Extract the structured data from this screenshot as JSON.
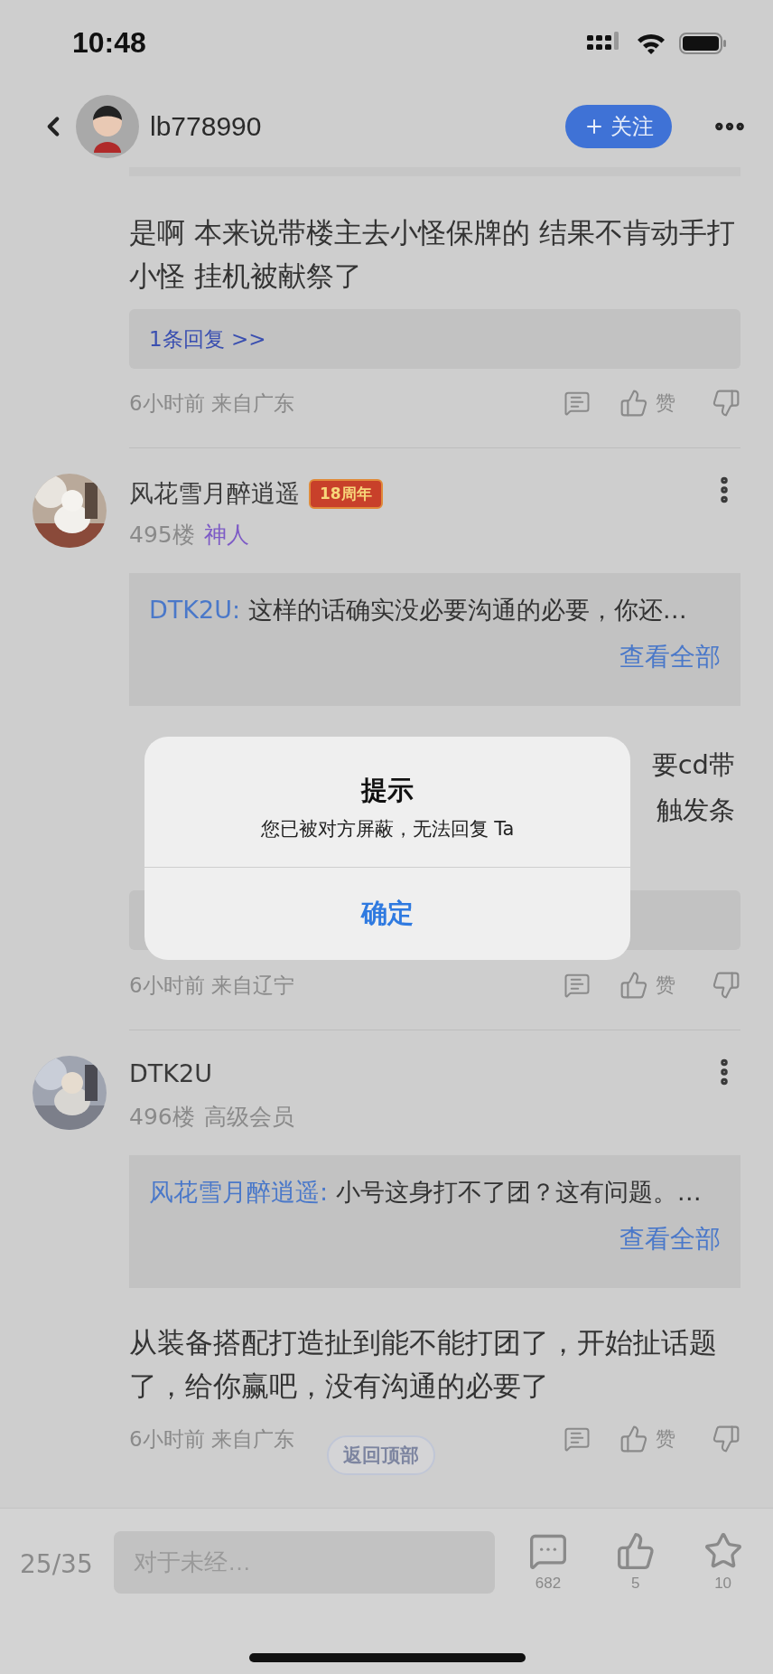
{
  "status_bar": {
    "time": "10:48"
  },
  "header": {
    "username": "lb778990",
    "follow_label": "关注"
  },
  "posts": [
    {
      "kind": "tail",
      "body": {
        "kind": "text",
        "text": "是啊 本来说带楼主去小怪保牌的 结果不肯动手打小怪 挂机被献祭了"
      },
      "replies": {
        "kind": "link",
        "text": "1条回复 >>"
      },
      "time": "6小时前",
      "location": "来自广东",
      "like_label": "赞"
    },
    {
      "kind": "full",
      "author": "风花雪月醉逍遥",
      "badge": "18周年",
      "floor": "495楼",
      "rank": {
        "text": "神人",
        "color": "#7d5bc6"
      },
      "quote": {
        "author": "DTK2U:",
        "text": "这样的话确实没必要沟通的必要，你还…",
        "more": "查看全部"
      },
      "body": {
        "kind": "covered",
        "lines": [
          "要cd带",
          "触发条"
        ]
      },
      "replies": {
        "kind": "covered"
      },
      "time": "6小时前",
      "location": "来自辽宁",
      "like_label": "赞"
    },
    {
      "kind": "full",
      "author": "DTK2U",
      "floor": "496楼",
      "rank": {
        "text": "高级会员",
        "color": "#8a8a8a"
      },
      "quote": {
        "author": "风花雪月醉逍遥:",
        "text": "小号这身打不了团？这有问题。…",
        "more": "查看全部"
      },
      "body": {
        "kind": "text",
        "text": "从装备搭配打造扯到能不能打团了，开始扯话题了，给你赢吧，没有沟通的必要了"
      },
      "time": "6小时前",
      "location": "来自广东",
      "like_label": "赞"
    }
  ],
  "back_to_top": "返回顶部",
  "bottom_bar": {
    "page": "25/35",
    "placeholder": "对于未经…",
    "comments": "682",
    "likes": "5",
    "favorites": "10"
  },
  "dialog": {
    "title": "提示",
    "message": "您已被对方屏蔽，无法回复 Ta",
    "button": "确定"
  }
}
